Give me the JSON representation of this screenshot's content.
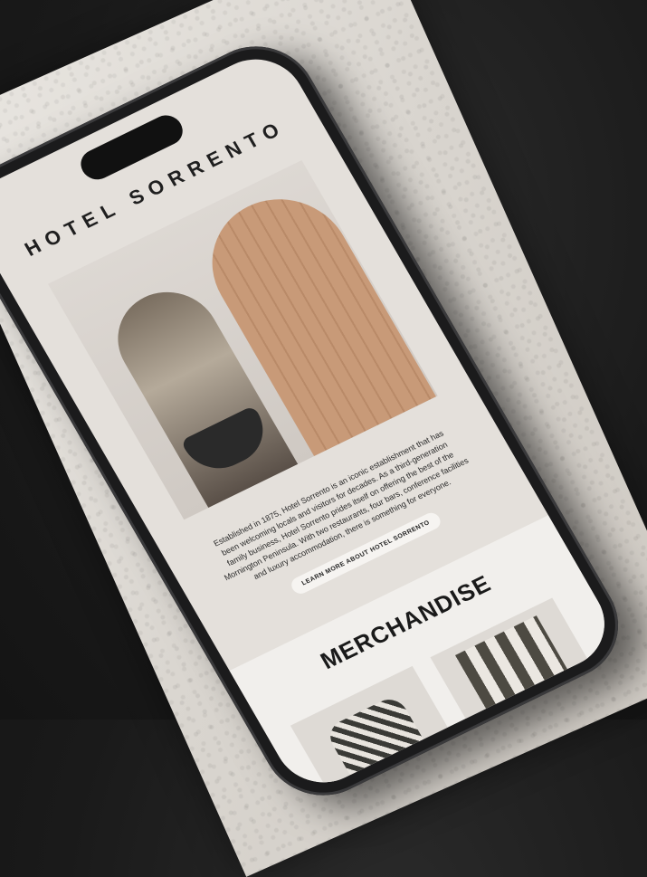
{
  "app": {
    "brand": "HOTEL SORRENTO"
  },
  "intro": {
    "text": "Established in 1875, Hotel Sorrento is an iconic establishment that has been welcoming locals and visitors for decades. As a third-generation family business, Hotel Sorrento prides itself on offering the best of the Mornington Peninsula. With two restaurants, four bars, conference facilities and luxury accommodation, there is something for everyone."
  },
  "cta": {
    "label": "LEARN MORE ABOUT HOTEL SORRENTO"
  },
  "merch": {
    "title": "MERCHANDISE"
  },
  "colors": {
    "screen_bg": "#e4e0db",
    "accent": "#1f1f1f"
  }
}
